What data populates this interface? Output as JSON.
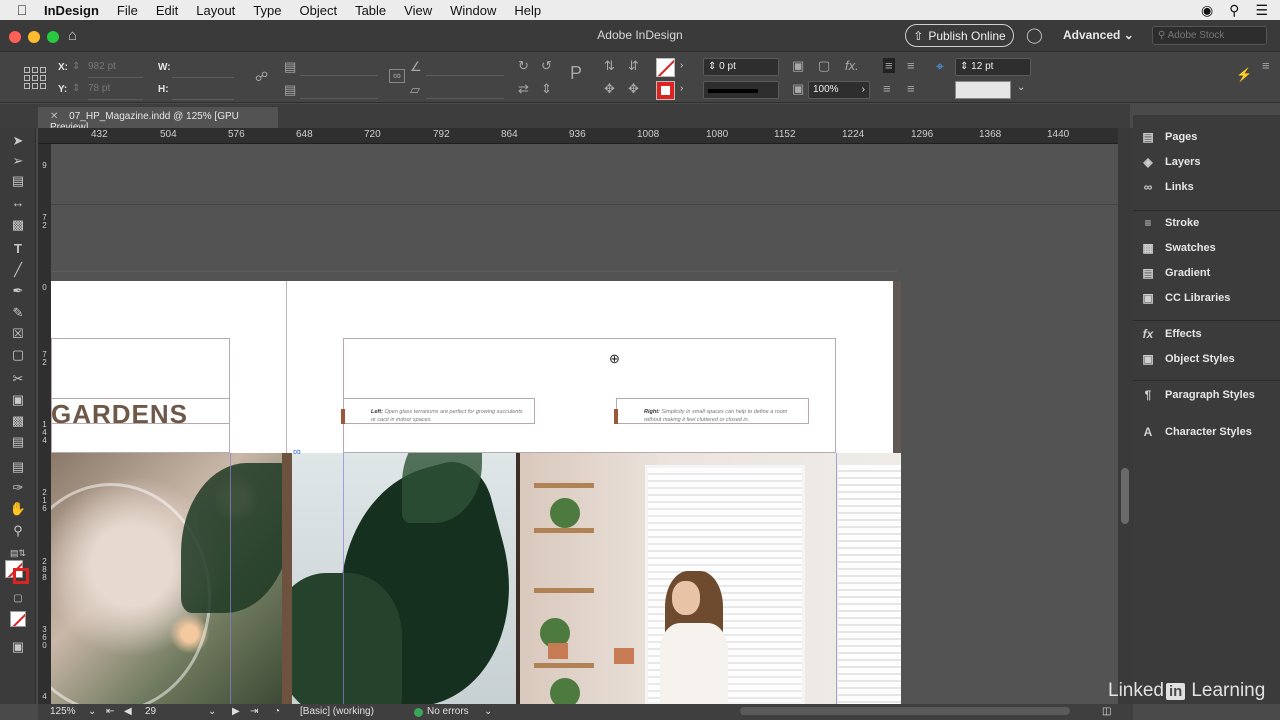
{
  "menubar": {
    "app": "InDesign",
    "items": [
      "File",
      "Edit",
      "Layout",
      "Type",
      "Object",
      "Table",
      "View",
      "Window",
      "Help"
    ]
  },
  "titlebar": {
    "title": "Adobe InDesign",
    "publish_label": "Publish Online",
    "workspace_label": "Advanced",
    "stock_placeholder": "Adobe Stock"
  },
  "control": {
    "x_label": "X:",
    "x_value": "982 pt",
    "y_label": "Y:",
    "y_value": "78 pt",
    "w_label": "W:",
    "h_label": "H:",
    "stroke_weight": "0 pt",
    "opacity": "100%",
    "gutter": "12 pt"
  },
  "document": {
    "tab_label": "07_HP_Magazine.indd @ 125% [GPU Preview]"
  },
  "ruler": {
    "h_ticks": [
      "432",
      "504",
      "576",
      "648",
      "720",
      "792",
      "864",
      "936",
      "1008",
      "1080",
      "1152",
      "1224",
      "1296",
      "1368",
      "1440"
    ],
    "v_ticks": [
      [
        "9"
      ],
      [
        "7",
        "2"
      ],
      [
        "0"
      ],
      [
        "7",
        "2"
      ],
      [
        "1",
        "4",
        "4"
      ],
      [
        "2",
        "1",
        "6"
      ],
      [
        "2",
        "8",
        "8"
      ],
      [
        "3",
        "6",
        "0"
      ],
      [
        "4"
      ]
    ]
  },
  "page": {
    "heading": "GARDENS",
    "caption_left_bold": "Left:",
    "caption_left_text": "Open glass terrariums are perfect for growing succulents or cacti in indoor spaces.",
    "caption_right_bold": "Right:",
    "caption_right_text": "Simplicity in small spaces can help to define a room without making it feel cluttered or closed in."
  },
  "panels": [
    {
      "label": "Pages",
      "icon": "pages-icon"
    },
    {
      "label": "Layers",
      "icon": "layers-icon"
    },
    {
      "label": "Links",
      "icon": "links-icon"
    },
    {
      "label": "Stroke",
      "icon": "stroke-icon"
    },
    {
      "label": "Swatches",
      "icon": "swatches-icon"
    },
    {
      "label": "Gradient",
      "icon": "gradient-icon"
    },
    {
      "label": "CC Libraries",
      "icon": "cc-libraries-icon"
    },
    {
      "label": "Effects",
      "icon": "effects-icon"
    },
    {
      "label": "Object Styles",
      "icon": "object-styles-icon"
    },
    {
      "label": "Paragraph Styles",
      "icon": "paragraph-styles-icon"
    },
    {
      "label": "Character Styles",
      "icon": "character-styles-icon"
    }
  ],
  "status": {
    "zoom": "125%",
    "page_number": "29",
    "style_state": "[Basic] (working)",
    "preflight": "No errors"
  },
  "watermark": {
    "text": "Linked",
    "badge": "in",
    "suffix": "Learning"
  },
  "colors": {
    "accent_red": "#d22222",
    "heading_brown": "#6e5847",
    "preflight_green": "#3aa657"
  }
}
